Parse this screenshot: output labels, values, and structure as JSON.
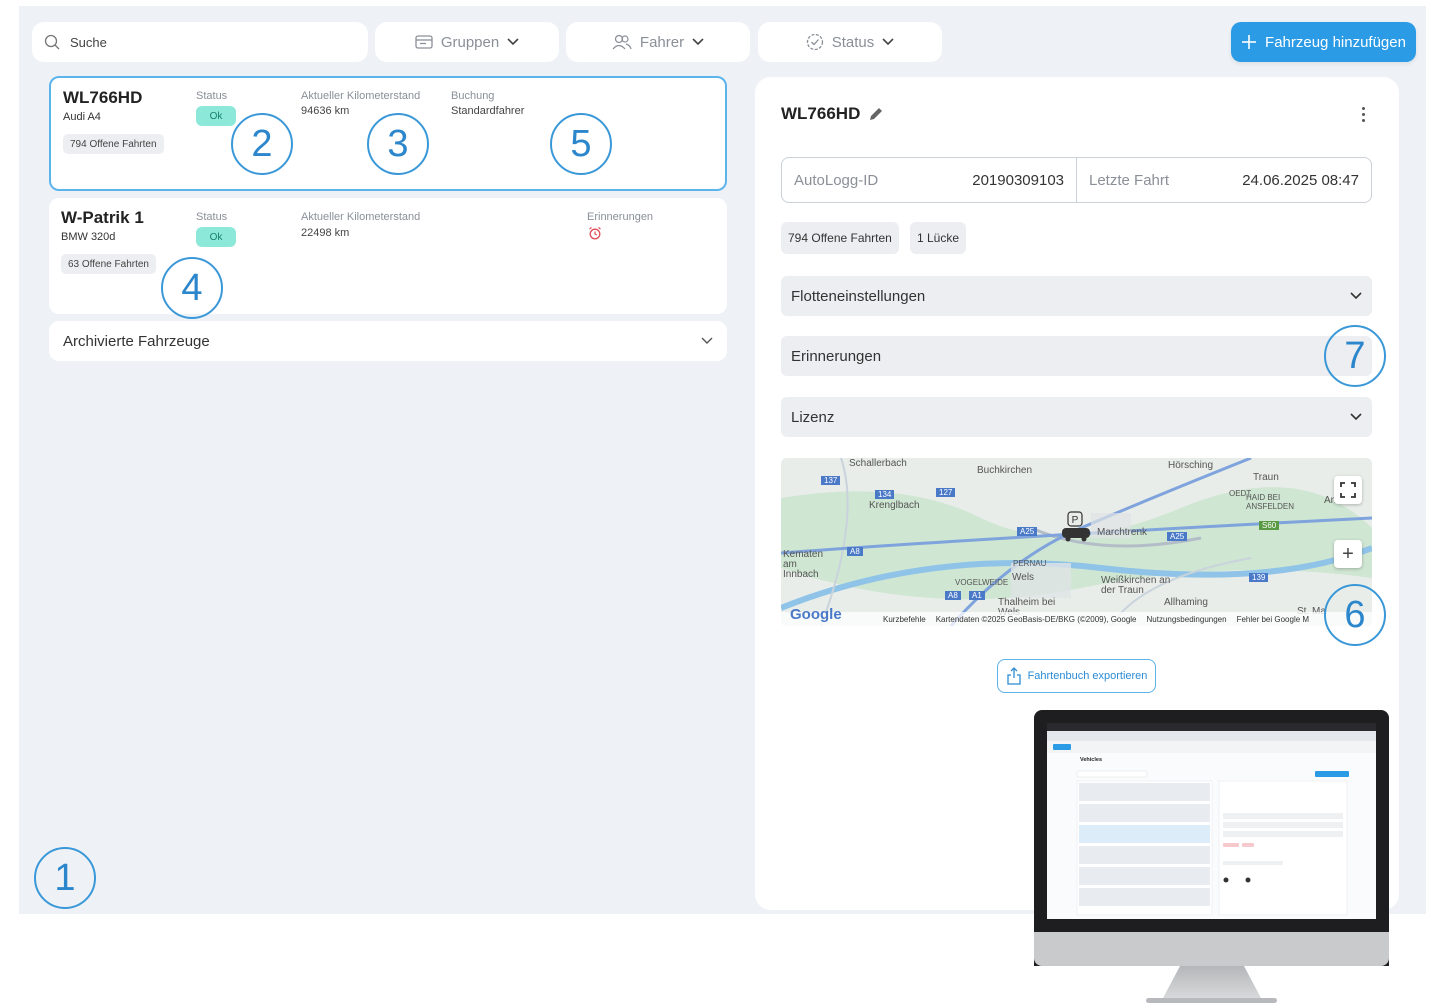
{
  "toolbar": {
    "search_placeholder": "Suche",
    "filter_groups": "Gruppen",
    "filter_driver": "Fahrer",
    "filter_status": "Status",
    "add_vehicle": "Fahrzeug hinzufügen"
  },
  "vehicles": [
    {
      "plate": "WL766HD",
      "model": "Audi A4",
      "status_label": "Status",
      "status": "Ok",
      "km_label": "Aktueller Kilometerstand",
      "km": "94636 km",
      "booking_label": "Buchung",
      "booking": "Standardfahrer",
      "open_trips": "794 Offene Fahrten"
    },
    {
      "plate": "W-Patrik 1",
      "model": "BMW 320d",
      "status_label": "Status",
      "status": "Ok",
      "km_label": "Aktueller Kilometerstand",
      "km": "22498 km",
      "reminders_label": "Erinnerungen",
      "open_trips": "63 Offene Fahrten"
    }
  ],
  "archived_label": "Archivierte Fahrzeuge",
  "detail": {
    "title": "WL766HD",
    "autologg_label": "AutoLogg-ID",
    "autologg_id": "20190309103",
    "last_trip_label": "Letzte Fahrt",
    "last_trip": "24.06.2025 08:47",
    "chip_open_trips": "794 Offene Fahrten",
    "chip_gaps": "1 Lücke",
    "sections": [
      "Flotteneinstellungen",
      "Erinnerungen",
      "Lizenz"
    ],
    "export_label": "Fahrtenbuch exportieren"
  },
  "map": {
    "places": [
      "Schallerbach",
      "Buchkirchen",
      "Hörsching",
      "Traun",
      "Krenglbach",
      "Marchtrenk",
      "Kematen am Innbach",
      "PERNAU",
      "Wels",
      "VOGELWEIDE",
      "Weißkirchen an der Traun",
      "Thalheim bei Wels",
      "Allhaming",
      "St. Ma",
      "OEDT",
      "HAID BEI ANSFELDEN",
      "Ansf"
    ],
    "roads": [
      "137",
      "134",
      "127",
      "A25",
      "A8",
      "A8",
      "A1",
      "A25",
      "139",
      "S60"
    ],
    "logo": "Google",
    "attribution": [
      "Kurzbefehle",
      "Kartendaten ©2025 GeoBasis-DE/BKG (©2009), Google",
      "Nutzungsbedingungen",
      "Fehler bei Google M"
    ],
    "zoom_in": "+"
  },
  "callouts": [
    "1",
    "2",
    "3",
    "4",
    "5",
    "6",
    "7"
  ],
  "monitor_preview": {
    "title": "Vehicles"
  },
  "colors": {
    "accent": "#2b9be6",
    "ok_badge": "#8ce8d9",
    "app_bg": "#eef2f6",
    "callout": "#3a98d8"
  }
}
